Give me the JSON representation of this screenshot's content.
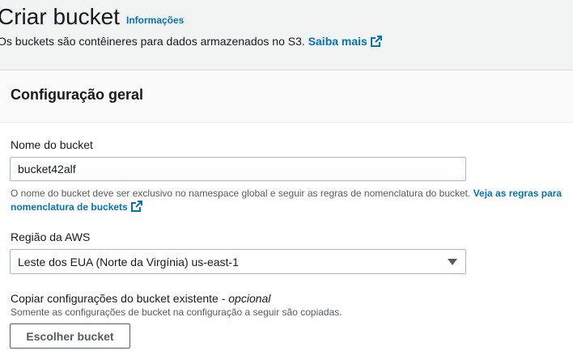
{
  "header": {
    "title": "Criar bucket",
    "info_link": "Informações",
    "description": "Os buckets são contêineres para dados armazenados no S3.",
    "learn_more": "Saiba mais",
    "learn_more_icon": "external-link-icon"
  },
  "general_config": {
    "title": "Configuração geral",
    "bucket_name": {
      "label": "Nome do bucket",
      "value": "bucket42alf",
      "hint": "O nome do bucket deve ser exclusivo no namespace global e seguir as regras de nomenclatura do bucket.",
      "hint_link": "Veja as regras para nomenclatura de buckets"
    },
    "region": {
      "label": "Região da AWS",
      "selected": "Leste dos EUA (Norte da Virgínia) us-east-1"
    },
    "copy_settings": {
      "label": "Copiar configurações do bucket existente -",
      "optional": "opcional",
      "hint": "Somente as configurações de bucket na configuração a seguir são copiadas.",
      "button": "Escolher bucket"
    }
  },
  "colors": {
    "link": "#0073bb",
    "text": "#16191f",
    "secondary_text": "#545b64",
    "background": "#f2f3f3"
  }
}
